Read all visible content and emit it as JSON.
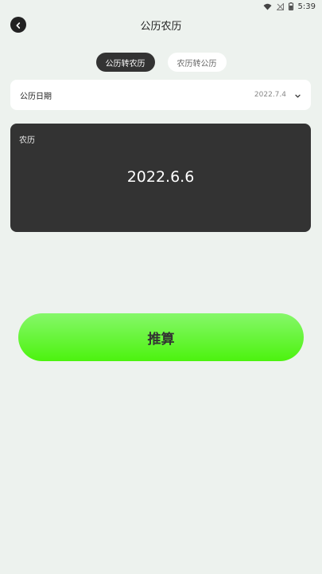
{
  "status_bar": {
    "time": "5:39"
  },
  "header": {
    "title": "公历农历"
  },
  "tabs": [
    {
      "label": "公历转农历",
      "active": true
    },
    {
      "label": "农历转公历",
      "active": false
    }
  ],
  "date_row": {
    "label": "公历日期",
    "value": "2022.7.4"
  },
  "result": {
    "label": "农历",
    "value": "2022.6.6"
  },
  "action": {
    "label": "推算"
  },
  "colors": {
    "background": "#edf2ee",
    "card": "#333333",
    "accent_top": "#86f76a",
    "accent_bottom": "#4cf30e"
  }
}
